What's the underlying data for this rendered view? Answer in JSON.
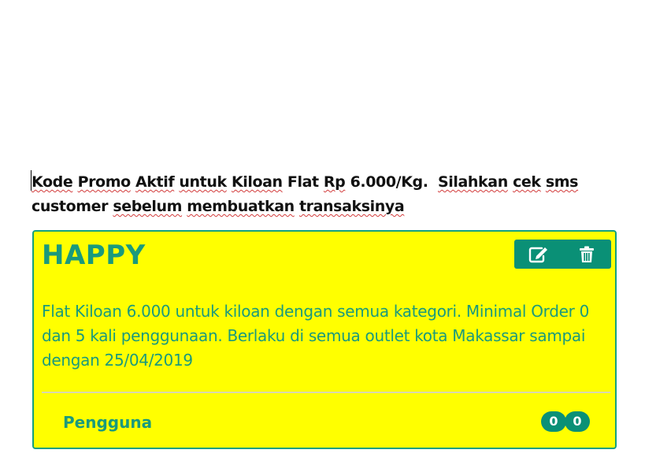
{
  "notice": {
    "words_line1": [
      "Kode",
      "Promo",
      "Aktif",
      "untuk",
      "Kiloan",
      "Flat",
      "Rp",
      "6.000/Kg.",
      "Silahkan",
      "cek",
      "sms"
    ],
    "words_line2": [
      "customer",
      "sebelum",
      "membuatkan",
      "transaksinya"
    ]
  },
  "promo": {
    "code": "HAPPY",
    "description": "Flat Kiloan 6.000 untuk kiloan dengan semua kategori. Minimal Order 0 dan 5 kali penggunaan. Berlaku di semua outlet kota Makassar sampai dengan 25/04/2019",
    "users_label": "Pengguna",
    "badge_values": [
      "0",
      "0"
    ],
    "actions": {
      "edit_icon": "edit-icon",
      "delete_icon": "trash-icon"
    }
  },
  "colors": {
    "card_background": "#ffff00",
    "accent": "#0a9076",
    "text_accent": "#1a9a7c"
  }
}
